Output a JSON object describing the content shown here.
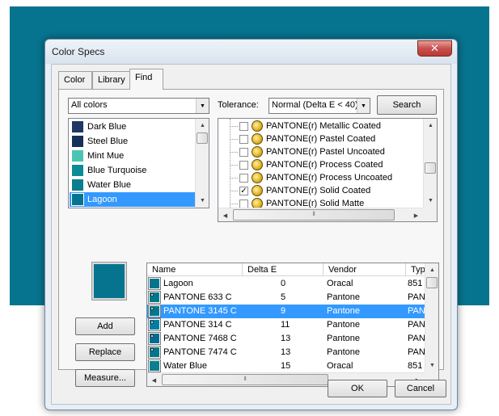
{
  "window": {
    "title": "Color Specs",
    "close_symbol": "✕"
  },
  "tabs": [
    {
      "label": "Color"
    },
    {
      "label": "Library"
    },
    {
      "label": "Find",
      "active": true
    }
  ],
  "filter": {
    "selected": "All colors"
  },
  "tolerance": {
    "label": "Tolerance:",
    "selected": "Normal (Delta E < 40)"
  },
  "search_button": "Search",
  "color_list": [
    {
      "name": "Dark Blue",
      "color": "#1f3864"
    },
    {
      "name": "Steel Blue",
      "color": "#17305a"
    },
    {
      "name": "Mint Mue",
      "color": "#4cc4b4"
    },
    {
      "name": "Blue Turquoise",
      "color": "#0d8a98"
    },
    {
      "name": "Water Blue",
      "color": "#0a7f8f"
    },
    {
      "name": "Lagoon",
      "color": "#07748f",
      "selected": true
    }
  ],
  "libraries": [
    {
      "name": "PANTONE(r) Metallic Coated",
      "checked": false
    },
    {
      "name": "PANTONE(r) Pastel Coated",
      "checked": false
    },
    {
      "name": "PANTONE(r) Pastel Uncoated",
      "checked": false
    },
    {
      "name": "PANTONE(r) Process Coated",
      "checked": false
    },
    {
      "name": "PANTONE(r) Process Uncoated",
      "checked": false
    },
    {
      "name": "PANTONE(r) Solid Coated",
      "checked": true
    },
    {
      "name": "PANTONE(r) Solid Matte",
      "checked": false
    }
  ],
  "current_swatch_color": "#07748f",
  "buttons": {
    "add": "Add",
    "replace": "Replace",
    "measure": "Measure...",
    "ok": "OK",
    "cancel": "Cancel"
  },
  "results": {
    "columns": [
      "Name",
      "Delta E",
      "Vendor",
      "Type"
    ],
    "rows": [
      {
        "name": "Lagoon",
        "delta": "0",
        "vendor": "Oracal",
        "type": "851",
        "color": "#07748f",
        "marker": false
      },
      {
        "name": "PANTONE 633 C",
        "delta": "5",
        "vendor": "Pantone",
        "type": "PANT",
        "color": "#00778b",
        "marker": true
      },
      {
        "name": "PANTONE 3145 C",
        "delta": "9",
        "vendor": "Pantone",
        "type": "PANT",
        "color": "#00778b",
        "marker": true,
        "selected": true
      },
      {
        "name": "PANTONE 314 C",
        "delta": "11",
        "vendor": "Pantone",
        "type": "PANT",
        "color": "#007fa3",
        "marker": true
      },
      {
        "name": "PANTONE 7468 C",
        "delta": "13",
        "vendor": "Pantone",
        "type": "PANT",
        "color": "#006d90",
        "marker": true
      },
      {
        "name": "PANTONE 7474 C",
        "delta": "13",
        "vendor": "Pantone",
        "type": "PANT",
        "color": "#00778b",
        "marker": true
      },
      {
        "name": "Water Blue",
        "delta": "15",
        "vendor": "Oracal",
        "type": "851",
        "color": "#0a7f8f",
        "marker": false
      }
    ]
  },
  "scroll_glyphs": {
    "up": "▲",
    "down": "▼",
    "left": "◀",
    "right": "▶",
    "grip_h": "≡",
    "grip_v": "⦀",
    "check": "✓"
  }
}
